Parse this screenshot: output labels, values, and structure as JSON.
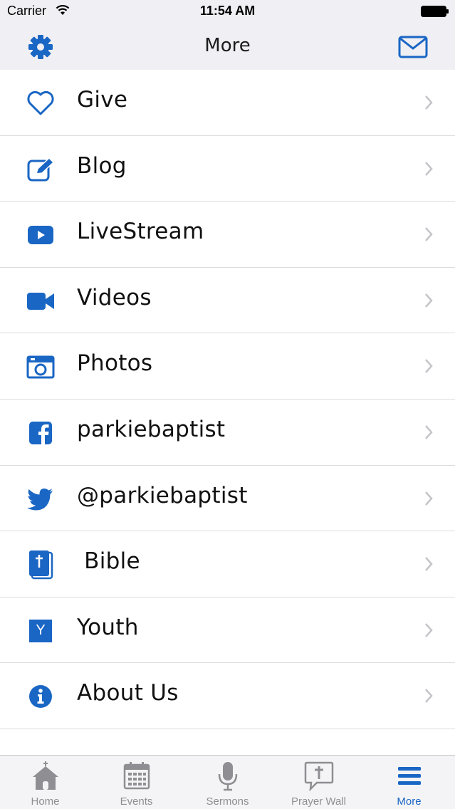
{
  "status_bar": {
    "carrier": "Carrier",
    "time": "11:54 AM"
  },
  "nav": {
    "title": "More",
    "left_icon": "gear-icon",
    "right_icon": "mail-icon"
  },
  "accent_color": "#1a66c4",
  "menu": [
    {
      "label": "Give",
      "icon": "heart-icon"
    },
    {
      "label": "Blog",
      "icon": "edit-icon"
    },
    {
      "label": "LiveStream",
      "icon": "youtube-play-icon"
    },
    {
      "label": "Videos",
      "icon": "video-camera-icon"
    },
    {
      "label": "Photos",
      "icon": "camera-icon"
    },
    {
      "label": "parkiebaptist",
      "icon": "facebook-icon"
    },
    {
      "label": "@parkiebaptist",
      "icon": "twitter-icon"
    },
    {
      "label": " Bible",
      "icon": "bible-icon"
    },
    {
      "label": "Youth",
      "icon": "youth-icon",
      "icon_text": "Y"
    },
    {
      "label": "About Us",
      "icon": "info-icon"
    }
  ],
  "tabs": [
    {
      "label": "Home",
      "icon": "church-icon"
    },
    {
      "label": "Events",
      "icon": "calendar-icon"
    },
    {
      "label": "Sermons",
      "icon": "microphone-icon"
    },
    {
      "label": "Prayer Wall",
      "icon": "prayer-icon"
    },
    {
      "label": "More",
      "icon": "menu-icon",
      "active": true
    }
  ]
}
